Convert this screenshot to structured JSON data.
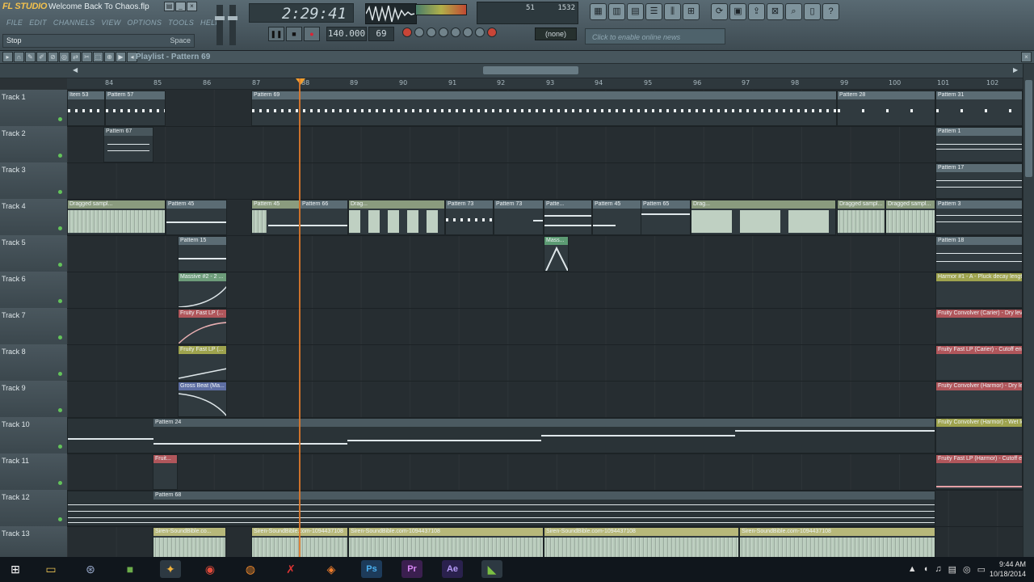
{
  "app": {
    "logo": "FL STUDIO",
    "title": "Welcome Back To Chaos.flp"
  },
  "menu": [
    "FILE",
    "EDIT",
    "CHANNELS",
    "VIEW",
    "OPTIONS",
    "TOOLS",
    "HELP"
  ],
  "hint": {
    "left": "Stop",
    "right": "Space"
  },
  "transport": {
    "time": "2:29:41",
    "bpm": "140.000",
    "pattern_num": "69",
    "cpu_a": "51",
    "cpu_b": "1532",
    "selector": "(none)",
    "online_banner": "Click to enable online news"
  },
  "playlist": {
    "title": "Playlist - Pattern 69"
  },
  "ruler": [
    "84",
    "85",
    "86",
    "87",
    "88",
    "89",
    "90",
    "91",
    "92",
    "93",
    "94",
    "95",
    "96",
    "97",
    "98",
    "99",
    "100",
    "101",
    "102"
  ],
  "tracks": [
    "Track 1",
    "Track 2",
    "Track 3",
    "Track 4",
    "Track 5",
    "Track 6",
    "Track 7",
    "Track 8",
    "Track 9",
    "Track 10",
    "Track 11",
    "Track 12",
    "Track 13"
  ],
  "clips": {
    "t1a": "Item 53",
    "t1b": "Pattern 57",
    "t1c": "Pattern 69",
    "t1d": "Pattern 28",
    "t1e": "Pattern 31",
    "t2a": "Pattern 67",
    "t2b": "Pattern 1",
    "t3a": "Pattern 17",
    "t4a": "Dragged sampl...",
    "t4b": "Pattern 45",
    "t4c": "Pattern 45",
    "t4d": "Pattern 66",
    "t4e": "Drag...",
    "t4f": "Pattern 73",
    "t4g": "Pattern 73",
    "t4h": "Patte...",
    "t4i": "Pattern 45",
    "t4j": "Pattern 65",
    "t4k": "Drag...",
    "t4l": "Dragged sampl...",
    "t4m": "Dragged sampl...",
    "t4n": "Pattern 3",
    "t5a": "Pattern 15",
    "t5b": "Mass...",
    "t5c": "Pattern 18",
    "t6a": "Massive #2 - 2 ...",
    "t6b": "Harmor #1 - A - Pluck decay lengt",
    "t7a": "Fruity Fast LP (...",
    "t7b": "Fruity Convolver (Carier) - Dry leve",
    "t8a": "Fruity Fast LP (...",
    "t8b": "Fruity Fast LP (Carier) - Cutoff ene",
    "t9a": "Gross Beat (Ma...",
    "t9b": "Fruity Convolver (Harmor) - Dry lev",
    "t10a": "Pattern 24",
    "t10b": "Fruity Convolver (Harmor) - Wet le",
    "t11a": "Fruit...",
    "t11b": "Fruity Fast LP (Harmor) - Cutoff en",
    "t12a": "Pattern 68",
    "t13a": "Siren-SoundBible.co...",
    "t13b": "Siren-SoundBible.com-1094437108",
    "t13c": "Siren-SoundBible.com-1094437108",
    "t13d": "Siren-SoundBible.com-1094437108",
    "t13e": "Siren-SoundBible.com-1094437108"
  },
  "clock": {
    "time": "9:44 AM",
    "date": "10/18/2014"
  },
  "colors": {
    "accent": "#e07a2c",
    "background": "#262d31",
    "title": "#f2c14e"
  }
}
